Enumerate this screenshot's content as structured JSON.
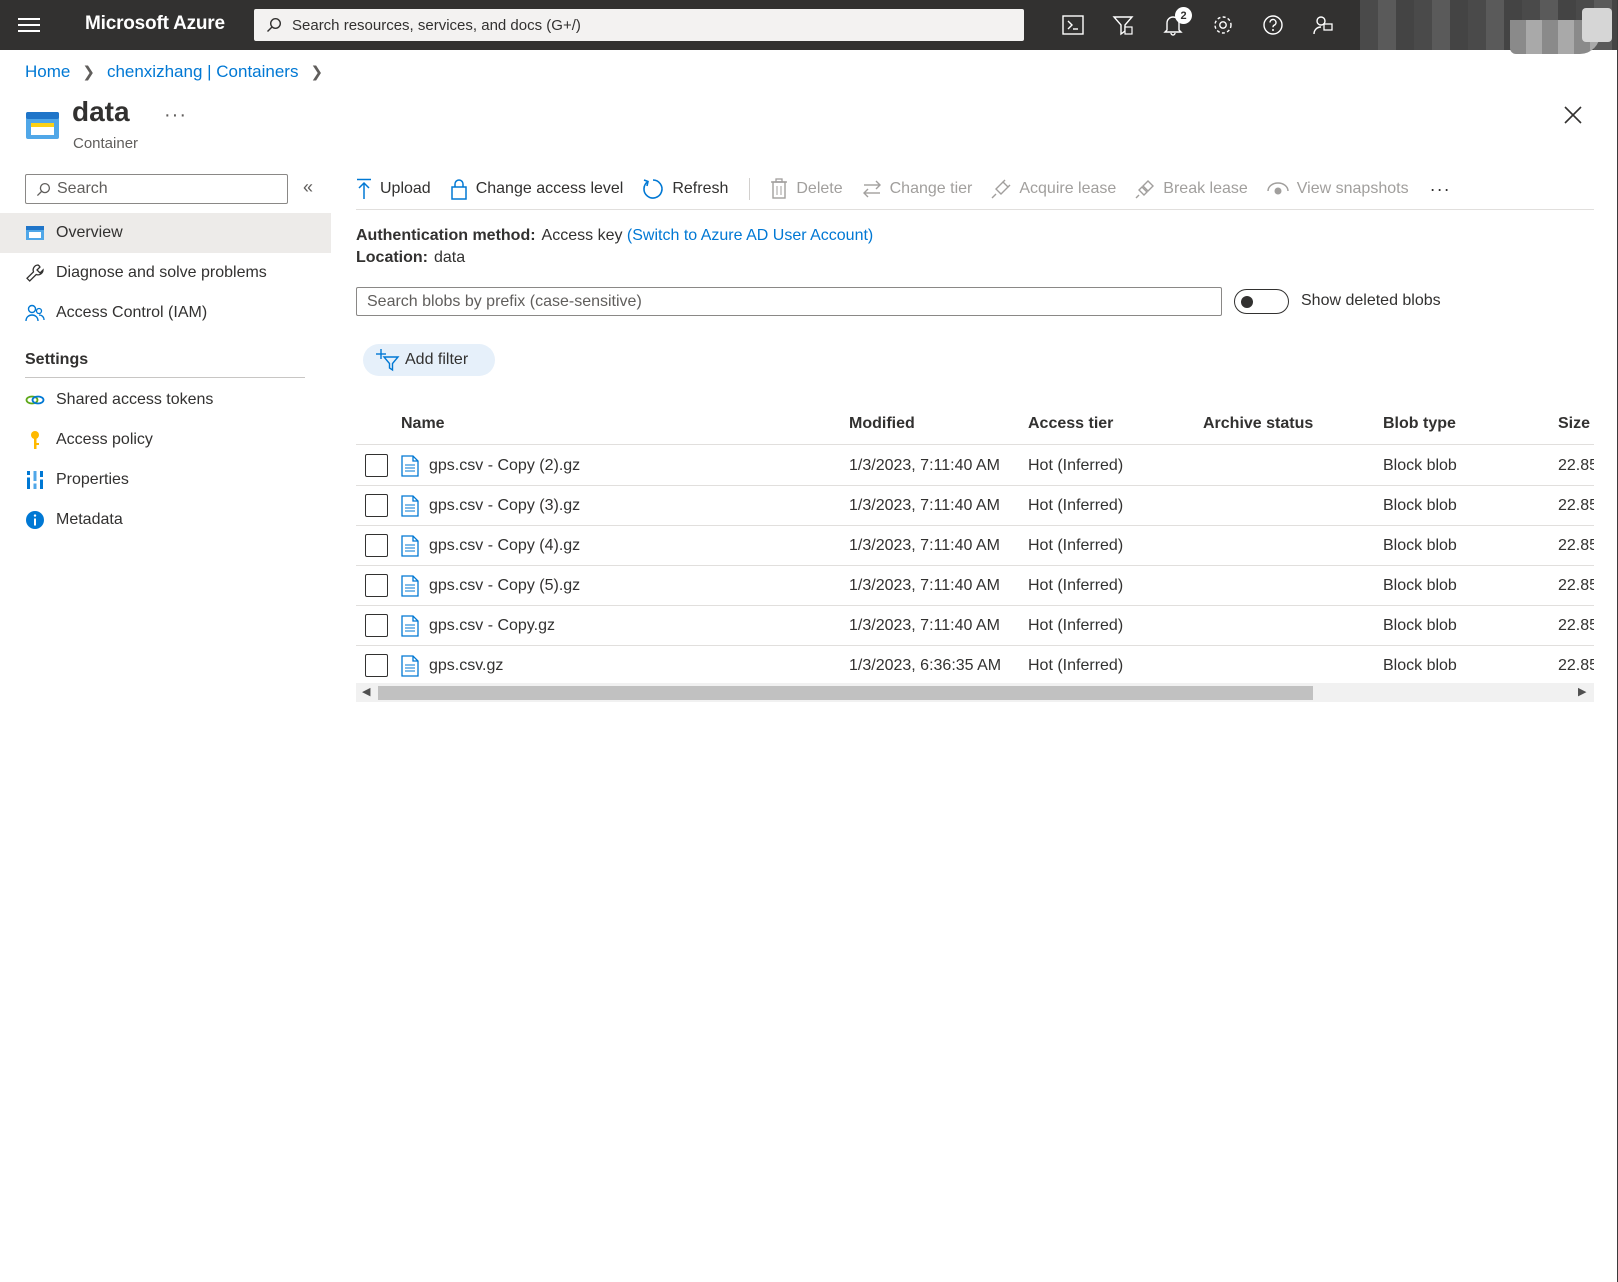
{
  "topbar": {
    "brand": "Microsoft Azure",
    "search_placeholder": "Search resources, services, and docs (G+/)",
    "notification_count": "2"
  },
  "breadcrumb": [
    "Home",
    "chenxizhang | Containers"
  ],
  "header": {
    "title": "data",
    "subtitle": "Container",
    "more": "···"
  },
  "sidebar": {
    "search_placeholder": "Search",
    "collapse": "«",
    "items": [
      {
        "label": "Overview",
        "icon": "container-icon",
        "active": true
      },
      {
        "label": "Diagnose and solve problems",
        "icon": "wrench-icon"
      },
      {
        "label": "Access Control (IAM)",
        "icon": "people-icon"
      }
    ],
    "settings_heading": "Settings",
    "settings_items": [
      {
        "label": "Shared access tokens",
        "icon": "link-icon"
      },
      {
        "label": "Access policy",
        "icon": "key-icon"
      },
      {
        "label": "Properties",
        "icon": "properties-icon"
      },
      {
        "label": "Metadata",
        "icon": "info-icon"
      }
    ]
  },
  "toolbar": {
    "upload": "Upload",
    "change_access_level": "Change access level",
    "refresh": "Refresh",
    "delete": "Delete",
    "change_tier": "Change tier",
    "acquire_lease": "Acquire lease",
    "break_lease": "Break lease",
    "view_snapshots": "View snapshots",
    "more": "···"
  },
  "info": {
    "auth_label": "Authentication method:",
    "auth_value": "Access key",
    "auth_link": "(Switch to Azure AD User Account)",
    "location_label": "Location:",
    "location_value": "data"
  },
  "blob_search": {
    "placeholder": "Search blobs by prefix (case-sensitive)",
    "show_deleted_label": "Show deleted blobs",
    "show_deleted": false
  },
  "add_filter": "Add filter",
  "table": {
    "columns": [
      "Name",
      "Modified",
      "Access tier",
      "Archive status",
      "Blob type",
      "Size"
    ],
    "rows": [
      {
        "name": "gps.csv - Copy (2).gz",
        "modified": "1/3/2023, 7:11:40 AM",
        "tier": "Hot (Inferred)",
        "archive": "",
        "type": "Block blob",
        "size": "22.85"
      },
      {
        "name": "gps.csv - Copy (3).gz",
        "modified": "1/3/2023, 7:11:40 AM",
        "tier": "Hot (Inferred)",
        "archive": "",
        "type": "Block blob",
        "size": "22.85"
      },
      {
        "name": "gps.csv - Copy (4).gz",
        "modified": "1/3/2023, 7:11:40 AM",
        "tier": "Hot (Inferred)",
        "archive": "",
        "type": "Block blob",
        "size": "22.85"
      },
      {
        "name": "gps.csv - Copy (5).gz",
        "modified": "1/3/2023, 7:11:40 AM",
        "tier": "Hot (Inferred)",
        "archive": "",
        "type": "Block blob",
        "size": "22.85"
      },
      {
        "name": "gps.csv - Copy.gz",
        "modified": "1/3/2023, 7:11:40 AM",
        "tier": "Hot (Inferred)",
        "archive": "",
        "type": "Block blob",
        "size": "22.85"
      },
      {
        "name": "gps.csv.gz",
        "modified": "1/3/2023, 6:36:35 AM",
        "tier": "Hot (Inferred)",
        "archive": "",
        "type": "Block blob",
        "size": "22.85"
      }
    ]
  },
  "colors": {
    "topbar": "#323130",
    "link": "#0078d4",
    "accent_filter_bg": "#e6f0fa"
  }
}
